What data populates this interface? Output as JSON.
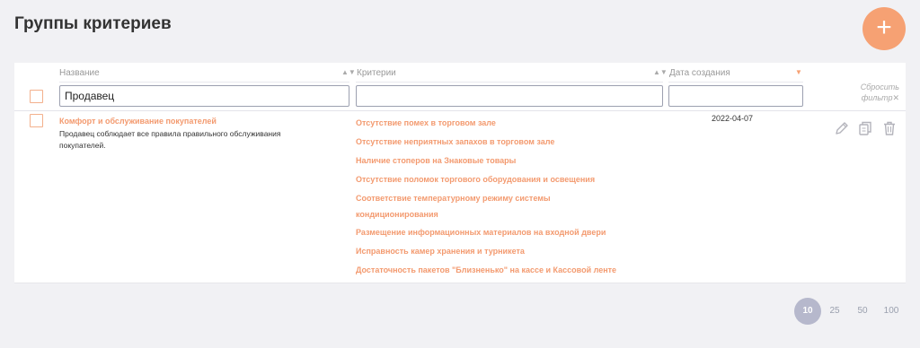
{
  "page_title": "Группы критериев",
  "add_button": "+",
  "columns": {
    "name": "Название",
    "criteria": "Критерии",
    "created": "Дата создания"
  },
  "filters": {
    "name_value": "Продавец",
    "criteria_value": "",
    "created_value": ""
  },
  "reset_filter": [
    "Сбросить",
    "фильтр"
  ],
  "rows": [
    {
      "name": "Комфорт и обслуживание покупателей",
      "description": "Продавец соблюдает все правила правильного обслуживания покупателей.",
      "criteria": [
        "Отсутствие помех в торговом зале",
        "Отсутствие неприятных запахов в торговом зале",
        "Наличие стоперов на Знаковые товары",
        "Отсутствие поломок торгового оборудования и освещения",
        "Соответствие температурному режиму системы",
        "кондиционирования",
        "Размещение информационных материалов на входной двери",
        "Исправность камер хранения и турникета",
        "Достаточность пакетов \"Близненько\" на кассе и Кассовой ленте"
      ],
      "created": "2022-04-07"
    }
  ],
  "pagination": {
    "options": [
      "10",
      "25",
      "50",
      "100"
    ],
    "selected": "10"
  },
  "colors": {
    "accent": "#f6a173",
    "link": "#f39a6f",
    "pager_active": "#b6b8cc"
  }
}
